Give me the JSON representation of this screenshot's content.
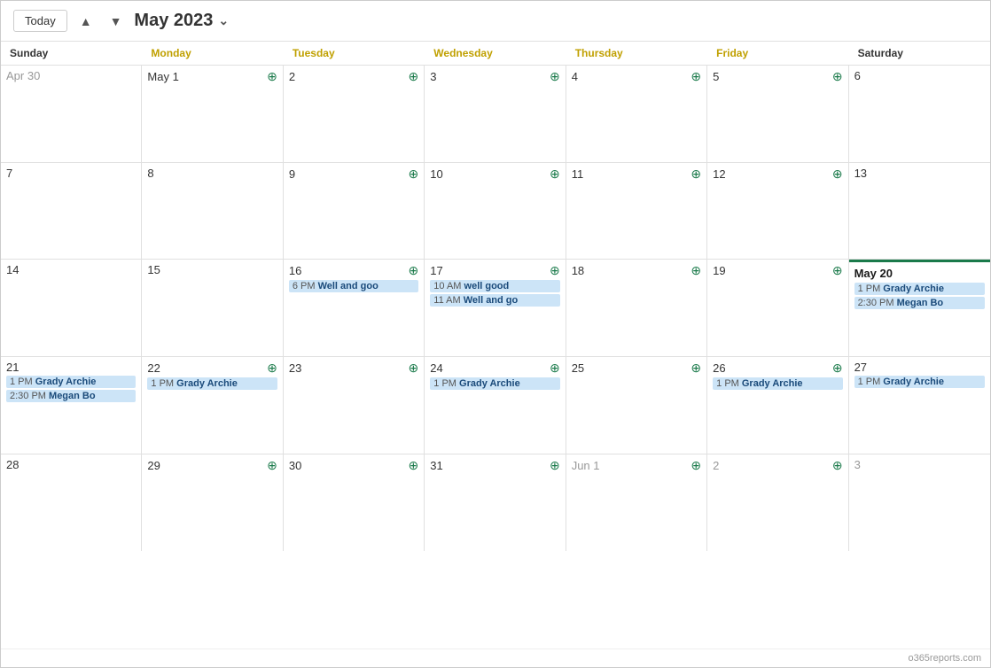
{
  "toolbar": {
    "today_label": "Today",
    "prev_icon": "▲",
    "next_icon": "▼",
    "month_title": "May 2023",
    "chevron": "⌄"
  },
  "day_headers": [
    "Sunday",
    "Monday",
    "Tuesday",
    "Wednesday",
    "Thursday",
    "Friday",
    "Saturday"
  ],
  "weeks": [
    {
      "days": [
        {
          "label": "Apr 30",
          "date_type": "other",
          "events": []
        },
        {
          "label": "May 1",
          "date_type": "current",
          "show_add": true,
          "bold": true,
          "events": []
        },
        {
          "label": "2",
          "date_type": "current",
          "show_add": true,
          "events": []
        },
        {
          "label": "3",
          "date_type": "current",
          "show_add": true,
          "events": []
        },
        {
          "label": "4",
          "date_type": "current",
          "show_add": true,
          "events": []
        },
        {
          "label": "5",
          "date_type": "current",
          "show_add": true,
          "events": []
        },
        {
          "label": "6",
          "date_type": "current",
          "events": []
        }
      ]
    },
    {
      "days": [
        {
          "label": "7",
          "date_type": "current",
          "events": []
        },
        {
          "label": "8",
          "date_type": "current",
          "events": []
        },
        {
          "label": "9",
          "date_type": "current",
          "show_add": true,
          "events": []
        },
        {
          "label": "10",
          "date_type": "current",
          "show_add": true,
          "events": []
        },
        {
          "label": "11",
          "date_type": "current",
          "show_add": true,
          "events": []
        },
        {
          "label": "12",
          "date_type": "current",
          "show_add": true,
          "events": []
        },
        {
          "label": "13",
          "date_type": "current",
          "events": []
        }
      ]
    },
    {
      "days": [
        {
          "label": "14",
          "date_type": "current",
          "events": []
        },
        {
          "label": "15",
          "date_type": "current",
          "events": []
        },
        {
          "label": "16",
          "date_type": "current",
          "show_add": true,
          "events": [
            {
              "time": "6 PM",
              "title": "Well and goo"
            }
          ]
        },
        {
          "label": "17",
          "date_type": "current",
          "show_add": true,
          "events": [
            {
              "time": "10 AM",
              "title": "well good"
            },
            {
              "time": "11 AM",
              "title": "Well and go"
            }
          ]
        },
        {
          "label": "18",
          "date_type": "current",
          "show_add": true,
          "events": []
        },
        {
          "label": "19",
          "date_type": "current",
          "show_add": true,
          "events": []
        },
        {
          "label": "May 20",
          "date_type": "today",
          "events": [
            {
              "time": "1 PM",
              "title": "Grady Archie"
            },
            {
              "time": "2:30 PM",
              "title": "Megan Bo"
            }
          ]
        }
      ]
    },
    {
      "days": [
        {
          "label": "21",
          "date_type": "current",
          "events": [
            {
              "time": "1 PM",
              "title": "Grady Archie"
            },
            {
              "time": "2:30 PM",
              "title": "Megan Bo"
            }
          ]
        },
        {
          "label": "22",
          "date_type": "current",
          "show_add": true,
          "events": [
            {
              "time": "1 PM",
              "title": "Grady Archie"
            }
          ]
        },
        {
          "label": "23",
          "date_type": "current",
          "show_add": true,
          "events": []
        },
        {
          "label": "24",
          "date_type": "current",
          "show_add": true,
          "events": [
            {
              "time": "1 PM",
              "title": "Grady Archie"
            }
          ]
        },
        {
          "label": "25",
          "date_type": "current",
          "show_add": true,
          "events": []
        },
        {
          "label": "26",
          "date_type": "current",
          "show_add": true,
          "events": [
            {
              "time": "1 PM",
              "title": "Grady Archie"
            }
          ]
        },
        {
          "label": "27",
          "date_type": "current",
          "events": [
            {
              "time": "1 PM",
              "title": "Grady Archie"
            }
          ]
        }
      ]
    },
    {
      "days": [
        {
          "label": "28",
          "date_type": "current",
          "events": []
        },
        {
          "label": "29",
          "date_type": "current",
          "show_add": true,
          "events": []
        },
        {
          "label": "30",
          "date_type": "current",
          "show_add": true,
          "events": []
        },
        {
          "label": "31",
          "date_type": "current",
          "show_add": true,
          "events": []
        },
        {
          "label": "Jun 1",
          "date_type": "other",
          "show_add": true,
          "events": []
        },
        {
          "label": "2",
          "date_type": "other",
          "show_add": true,
          "events": []
        },
        {
          "label": "3",
          "date_type": "other",
          "events": []
        }
      ]
    }
  ],
  "footer": {
    "watermark": "o365reports.com"
  },
  "add_icon": "⊕"
}
